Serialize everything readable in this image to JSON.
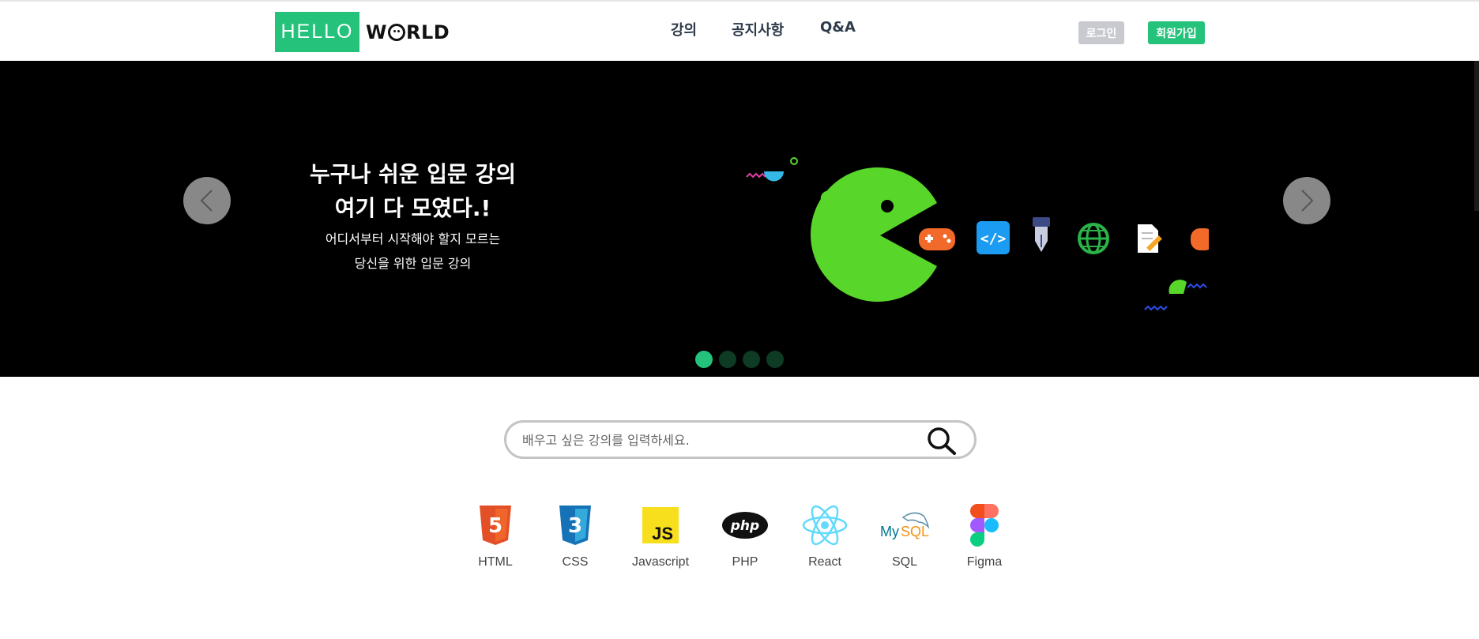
{
  "header": {
    "logo_hello": "HELLO",
    "logo_world_w": "W",
    "logo_world_rest": "RLD",
    "nav": [
      "강의",
      "공지사항",
      "Q&A"
    ],
    "login_label": "로그인",
    "signup_label": "회원가입"
  },
  "hero": {
    "title_line1": "누구나 쉬운 입문 강의",
    "title_line2": "여기 다 모였다.!",
    "sub_line1": "어디서부터 시작해야 할지 모르는",
    "sub_line2": "당신을 위한 입문 강의",
    "slide_count": 4,
    "active_slide": 1,
    "illustration_icons": [
      "pacman-icon",
      "gamepad-icon",
      "code-icon",
      "pen-nib-icon",
      "globe-icon",
      "document-edit-icon"
    ]
  },
  "search": {
    "placeholder": "배우고 싶은 강의를 입력하세요.",
    "value": ""
  },
  "categories": [
    {
      "label": "HTML",
      "icon": "html5-icon"
    },
    {
      "label": "CSS",
      "icon": "css3-icon"
    },
    {
      "label": "Javascript",
      "icon": "javascript-icon"
    },
    {
      "label": "PHP",
      "icon": "php-icon"
    },
    {
      "label": "React",
      "icon": "react-icon"
    },
    {
      "label": "SQL",
      "icon": "mysql-icon"
    },
    {
      "label": "Figma",
      "icon": "figma-icon"
    }
  ],
  "colors": {
    "brand_green": "#24c27a",
    "hero_bg": "#000000",
    "login_bg": "#c8cad0"
  }
}
